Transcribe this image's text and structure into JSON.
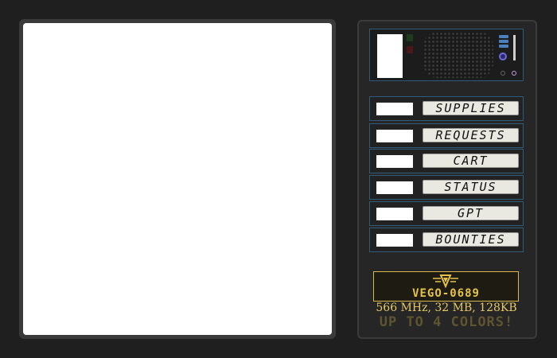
{
  "menu": {
    "items": [
      {
        "label": "SUPPLIES"
      },
      {
        "label": "REQUESTS"
      },
      {
        "label": "CART"
      },
      {
        "label": "STATUS"
      },
      {
        "label": "GPT"
      },
      {
        "label": "BOUNTIES"
      }
    ]
  },
  "branding": {
    "name": "VEGO-0689",
    "specs": "566 MHz, 32 MB, 128KB",
    "tagline": "UP TO 4 COLORS!",
    "accent_color": "#e6c24a"
  },
  "icons": {
    "speaker": "speaker-grille-icon",
    "power": "power-knob-icon",
    "logo": "vego-logo-icon"
  }
}
